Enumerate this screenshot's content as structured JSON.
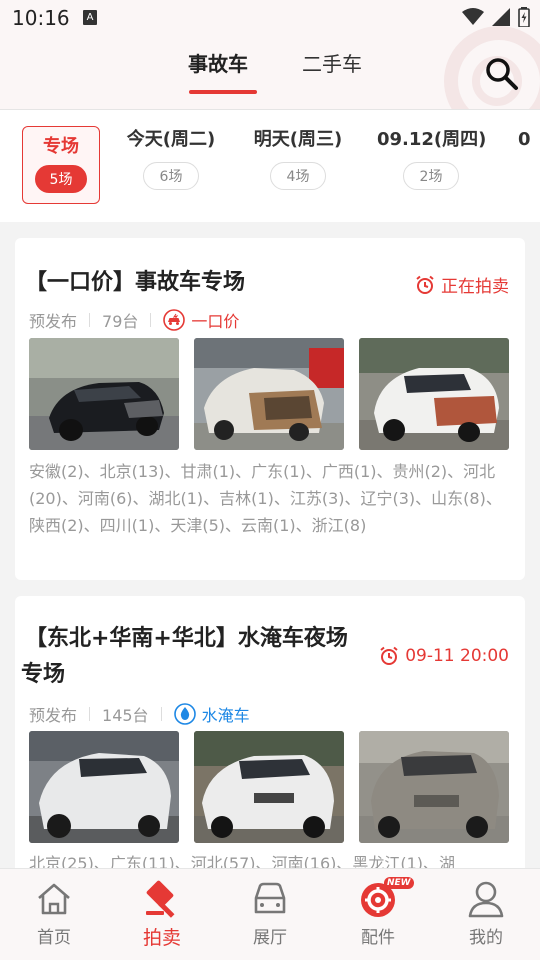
{
  "status_bar": {
    "time": "10:16",
    "notif": "A"
  },
  "top_tabs": {
    "active": "事故车",
    "inactive": "二手车"
  },
  "date_tabs": [
    {
      "label": "专场",
      "count": "5场"
    },
    {
      "label": "今天(周二)",
      "count": "6场"
    },
    {
      "label": "明天(周三)",
      "count": "4场"
    },
    {
      "label": "09.12(周四)",
      "count": "2场"
    },
    {
      "label": "0",
      "count": ""
    }
  ],
  "cards": [
    {
      "title": "【一口价】事故车专场",
      "status": "正在拍卖",
      "meta_release": "预发布",
      "meta_count": "79台",
      "badge": "一口价",
      "regions": "安徽(2)、北京(13)、甘肃(1)、广东(1)、广西(1)、贵州(2)、河北(20)、河南(6)、湖北(1)、吉林(1)、江苏(3)、辽宁(3)、山东(8)、陕西(2)、四川(1)、天津(5)、云南(1)、浙江(8)"
    },
    {
      "title_line1": "【东北+华南+华北】水淹车夜场",
      "title_line2": "专场",
      "status": "09-11 20:00",
      "meta_release": "预发布",
      "meta_count": "145台",
      "badge": "水淹车",
      "regions": "北京(25)、广东(11)、河北(57)、河南(16)、黑龙江(1)、湖"
    }
  ],
  "bottom_nav": [
    {
      "label": "首页"
    },
    {
      "label": "拍卖"
    },
    {
      "label": "展厅"
    },
    {
      "label": "配件",
      "badge": "NEW"
    },
    {
      "label": "我的"
    }
  ],
  "colors": {
    "accent": "#e53935",
    "water": "#1e88e5"
  }
}
